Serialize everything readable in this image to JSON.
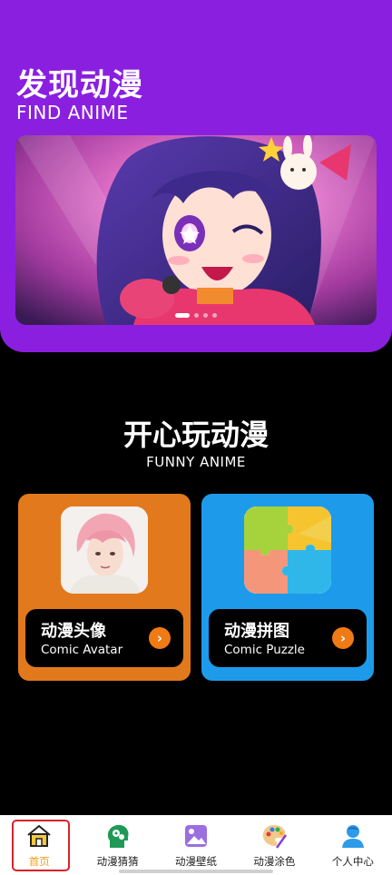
{
  "hero": {
    "title": "发现动漫",
    "subtitle": "FIND ANIME",
    "banner_icon": "anime-banner-image",
    "carousel_pages": 4,
    "carousel_active": 1
  },
  "section": {
    "title": "开心玩动漫",
    "subtitle": "FUNNY ANIME"
  },
  "cards": [
    {
      "title": "动漫头像",
      "subtitle": "Comic Avatar",
      "color": "#e2791c",
      "icon": "anime-avatar-thumbnail"
    },
    {
      "title": "动漫拼图",
      "subtitle": "Comic Puzzle",
      "color": "#1d9bea",
      "icon": "puzzle-thumbnail"
    }
  ],
  "nav": [
    {
      "label": "首页",
      "icon": "home-icon",
      "active": true
    },
    {
      "label": "动漫猜猜",
      "icon": "guess-head-icon",
      "active": false
    },
    {
      "label": "动漫壁纸",
      "icon": "wallpaper-icon",
      "active": false
    },
    {
      "label": "动漫涂色",
      "icon": "palette-icon",
      "active": false
    },
    {
      "label": "个人中心",
      "icon": "user-icon",
      "active": false
    }
  ],
  "colors": {
    "hero_bg": "#8a1fe0",
    "accent": "#f07a14",
    "nav_active": "#f0a020",
    "highlight_border": "#d8232a"
  }
}
